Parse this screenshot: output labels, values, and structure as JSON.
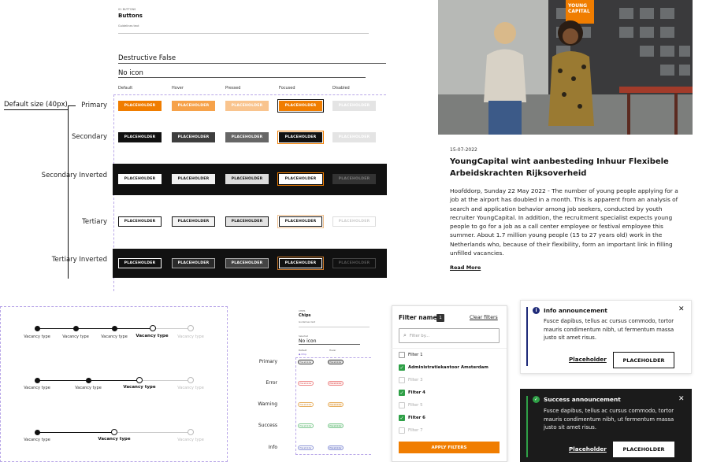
{
  "doc": {
    "section": "01 BUTTONS",
    "title": "Buttons",
    "subtitle": "Guidelines text"
  },
  "props": {
    "destructive": "Destructive False",
    "icon": "No icon"
  },
  "columns": [
    "Default",
    "Hover",
    "Pressed",
    "Focused",
    "Disabled"
  ],
  "size_label": "Default size (40px)",
  "rows": [
    "Primary",
    "Secondary",
    "Secondary Inverted",
    "Tertiary",
    "Tertiary Inverted"
  ],
  "btn_label": "PLACEHOLDER",
  "colors": {
    "orange": "#f07d00",
    "dark": "#111111",
    "green": "#2fa047",
    "navy": "#1e2a78"
  },
  "article": {
    "logo": "YOUNG CAPITAL",
    "date": "15-07-2022",
    "title": "YoungCapital wint aanbesteding Inhuur Flexibele Arbeidskrachten Rijksoverheid",
    "body": "Hoofddorp, Sunday 22 May 2022 - The number of young people applying for a job at the airport has doubled in a month. This is apparent from an analysis of search and application behavior among job seekers, conducted by youth recruiter YoungCapital. In addition, the recruitment specialist expects young people to go for a job as a call center employee or festival employee this summer. About 1.7 million young people (15 to 27 years old) work in the Netherlands who, because of their flexibility, form an important link in filling unfilled vacancies.",
    "read_more": "Read More"
  },
  "stepper": {
    "label": "Vacancy type"
  },
  "chips": {
    "section": "CHIPS",
    "title": "Chips",
    "subtitle": "Guidelines text",
    "prop": "No icon",
    "prop_small": "Selected",
    "cols": [
      "Default",
      "Hover"
    ],
    "chip_sample": "Chip",
    "chip_label": "Placeholder",
    "rows": [
      "Primary",
      "Error",
      "Warning",
      "Success",
      "Info"
    ]
  },
  "filter": {
    "title": "Filter name",
    "count": "1",
    "clear": "Clear filters",
    "search_placeholder": "Filter by...",
    "items": [
      {
        "label": "Filter 1",
        "checked": false
      },
      {
        "label": "Administratiekantoor Amsterdam",
        "checked": true
      },
      {
        "label": "Filter 3",
        "checked": false
      },
      {
        "label": "Filter 4",
        "checked": true
      },
      {
        "label": "Filter 5",
        "checked": false
      },
      {
        "label": "Filter 6",
        "checked": true
      },
      {
        "label": "Filter 7",
        "checked": false
      }
    ],
    "apply": "APPLY FILTERS"
  },
  "info_ann": {
    "title": "Info announcement",
    "body": "Fusce dapibus, tellus ac cursus commodo, tortor mauris condimentum nibh, ut fermentum massa justo sit amet risus.",
    "link": "Placeholder",
    "button": "PLACEHOLDER"
  },
  "success_ann": {
    "title": "Success announcement",
    "body": "Fusce dapibus, tellus ac cursus commodo, tortor mauris condimentum nibh, ut fermentum massa justo sit amet risus.",
    "link": "Placeholder",
    "button": "PLACEHOLDER"
  }
}
